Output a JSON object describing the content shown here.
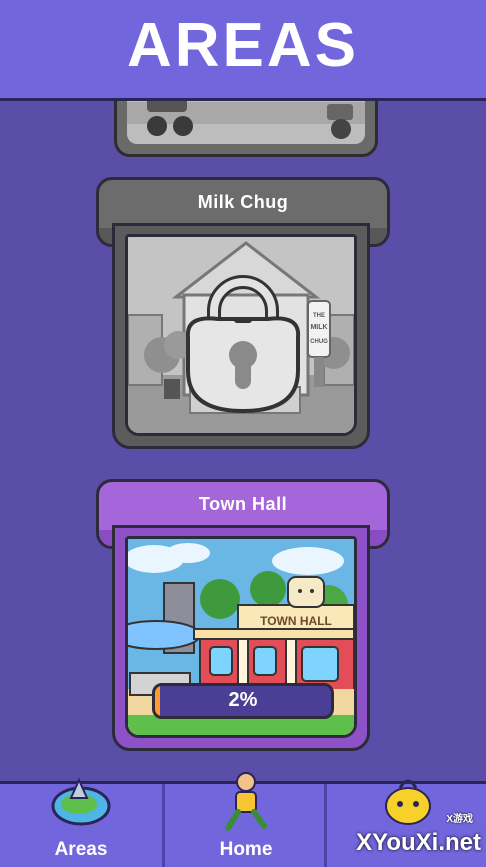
{
  "header": {
    "title": "AREAS"
  },
  "areas": [
    {
      "name": "Milk Chug",
      "locked": true
    },
    {
      "name": "Town Hall",
      "locked": false,
      "progress_label": "2%",
      "progress": 0.02
    }
  ],
  "town_hall_sign": "TOWN HALL",
  "milk_sign": "THE MILK CHUG",
  "nav": {
    "items": [
      {
        "label": "Areas",
        "icon": "globe-icon"
      },
      {
        "label": "Home",
        "icon": "runner-icon"
      },
      {
        "label": "",
        "icon": "creature-icon"
      }
    ]
  },
  "watermark": {
    "text": "XYouXi.net",
    "small": "X游戏"
  },
  "colors": {
    "header": "#7266dc",
    "background": "#5a4ea8",
    "accent_purple": "#a566dc",
    "progress": "#ff9b2e"
  }
}
